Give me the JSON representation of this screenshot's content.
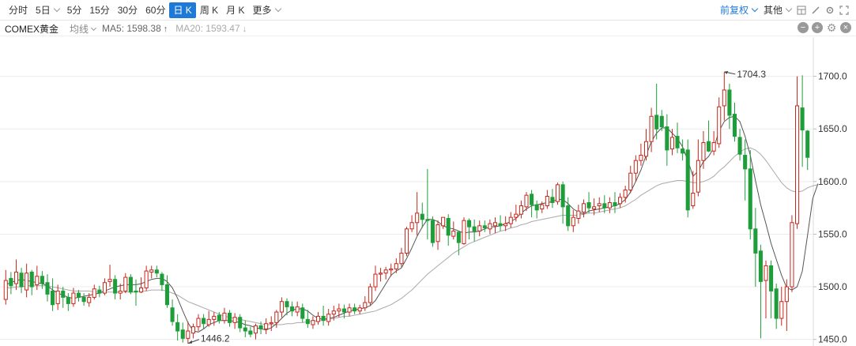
{
  "toolbar": {
    "tabs": [
      {
        "label": "分时",
        "caret": false
      },
      {
        "label": "5日",
        "caret": true
      },
      {
        "label": "5分",
        "caret": false
      },
      {
        "label": "15分",
        "caret": false
      },
      {
        "label": "30分",
        "caret": false
      },
      {
        "label": "60分",
        "caret": false
      },
      {
        "label": "日 K",
        "caret": false,
        "active": true
      },
      {
        "label": "周 K",
        "caret": false
      },
      {
        "label": "月 K",
        "caret": false
      },
      {
        "label": "更多",
        "caret": true
      }
    ],
    "adjust_label": "前复权",
    "other_label": "其他"
  },
  "legend": {
    "symbol": "COMEX黄金",
    "ma_selector": "均线",
    "ma5": "MA5: 1598.38",
    "ma5_arrow": "↑",
    "ma20": "MA20: 1593.47",
    "ma20_arrow": "↓"
  },
  "colors": {
    "up": "#c5281c",
    "down": "#1e9e3a",
    "ma5": "#555555",
    "ma20": "#aaaaaa",
    "accent": "#1e7ad6"
  },
  "chart_data": {
    "type": "candlestick",
    "yticks": [
      "1700.0",
      "1650.0",
      "1600.0",
      "1550.0",
      "1500.0",
      "1450.0"
    ],
    "ylim": [
      1446,
      1735
    ],
    "max_label": "1704.3",
    "min_label": "1446.2",
    "candles": [
      [
        1488,
        1506,
        1516,
        1483
      ],
      [
        1508,
        1501,
        1514,
        1493
      ],
      [
        1503,
        1514,
        1526,
        1497
      ],
      [
        1513,
        1500,
        1518,
        1494
      ],
      [
        1497,
        1513,
        1522,
        1490
      ],
      [
        1514,
        1500,
        1516,
        1492
      ],
      [
        1502,
        1510,
        1520,
        1497
      ],
      [
        1510,
        1503,
        1515,
        1498
      ],
      [
        1504,
        1493,
        1512,
        1486
      ],
      [
        1496,
        1483,
        1508,
        1477
      ],
      [
        1484,
        1496,
        1502,
        1478
      ],
      [
        1496,
        1490,
        1500,
        1480
      ],
      [
        1490,
        1484,
        1494,
        1477
      ],
      [
        1484,
        1494,
        1499,
        1481
      ],
      [
        1494,
        1490,
        1497,
        1486
      ],
      [
        1490,
        1486,
        1494,
        1482
      ],
      [
        1485,
        1490,
        1494,
        1481
      ],
      [
        1490,
        1498,
        1502,
        1488
      ],
      [
        1497,
        1494,
        1501,
        1490
      ],
      [
        1494,
        1504,
        1508,
        1492
      ],
      [
        1505,
        1507,
        1521,
        1500
      ],
      [
        1507,
        1494,
        1511,
        1488
      ],
      [
        1494,
        1496,
        1503,
        1488
      ],
      [
        1496,
        1509,
        1513,
        1494
      ],
      [
        1509,
        1495,
        1512,
        1493
      ],
      [
        1496,
        1495,
        1507,
        1482
      ],
      [
        1495,
        1499,
        1509,
        1494
      ],
      [
        1499,
        1515,
        1520,
        1496
      ],
      [
        1514,
        1516,
        1520,
        1508
      ],
      [
        1516,
        1513,
        1520,
        1509
      ],
      [
        1512,
        1502,
        1514,
        1496
      ],
      [
        1502,
        1483,
        1511,
        1480
      ],
      [
        1480,
        1467,
        1488,
        1463
      ],
      [
        1466,
        1458,
        1474,
        1449
      ],
      [
        1459,
        1451,
        1466,
        1447
      ],
      [
        1451,
        1458,
        1467,
        1446
      ],
      [
        1456,
        1462,
        1465,
        1451
      ],
      [
        1462,
        1470,
        1474,
        1458
      ],
      [
        1470,
        1465,
        1474,
        1460
      ],
      [
        1464,
        1469,
        1477,
        1462
      ],
      [
        1469,
        1472,
        1476,
        1463
      ],
      [
        1473,
        1468,
        1476,
        1465
      ],
      [
        1468,
        1475,
        1480,
        1465
      ],
      [
        1475,
        1466,
        1478,
        1462
      ],
      [
        1466,
        1471,
        1475,
        1460
      ],
      [
        1471,
        1461,
        1474,
        1457
      ],
      [
        1461,
        1458,
        1468,
        1452
      ],
      [
        1458,
        1455,
        1462,
        1452
      ],
      [
        1456,
        1463,
        1465,
        1450
      ],
      [
        1463,
        1460,
        1467,
        1455
      ],
      [
        1460,
        1465,
        1470,
        1455
      ],
      [
        1465,
        1466,
        1472,
        1458
      ],
      [
        1466,
        1476,
        1478,
        1461
      ],
      [
        1476,
        1486,
        1490,
        1471
      ],
      [
        1486,
        1481,
        1489,
        1473
      ],
      [
        1481,
        1477,
        1486,
        1472
      ],
      [
        1476,
        1481,
        1486,
        1472
      ],
      [
        1480,
        1470,
        1484,
        1466
      ],
      [
        1469,
        1465,
        1478,
        1461
      ],
      [
        1464,
        1468,
        1472,
        1460
      ],
      [
        1467,
        1472,
        1476,
        1464
      ],
      [
        1472,
        1468,
        1482,
        1463
      ],
      [
        1467,
        1474,
        1479,
        1463
      ],
      [
        1474,
        1477,
        1482,
        1468
      ],
      [
        1477,
        1479,
        1484,
        1471
      ],
      [
        1479,
        1476,
        1483,
        1470
      ],
      [
        1476,
        1480,
        1484,
        1472
      ],
      [
        1480,
        1477,
        1484,
        1474
      ],
      [
        1477,
        1480,
        1483,
        1474
      ],
      [
        1480,
        1485,
        1491,
        1477
      ],
      [
        1485,
        1500,
        1503,
        1482
      ],
      [
        1500,
        1512,
        1520,
        1496
      ],
      [
        1512,
        1513,
        1518,
        1505
      ],
      [
        1513,
        1516,
        1519,
        1507
      ],
      [
        1516,
        1517,
        1522,
        1510
      ],
      [
        1517,
        1522,
        1527,
        1513
      ],
      [
        1522,
        1532,
        1537,
        1519
      ],
      [
        1532,
        1555,
        1557,
        1529
      ],
      [
        1555,
        1561,
        1568,
        1552
      ],
      [
        1561,
        1570,
        1590,
        1549
      ],
      [
        1569,
        1564,
        1580,
        1556
      ],
      [
        1564,
        1563,
        1612,
        1545
      ],
      [
        1563,
        1542,
        1567,
        1538
      ],
      [
        1543,
        1559,
        1563,
        1535
      ],
      [
        1558,
        1566,
        1566,
        1555
      ],
      [
        1565,
        1549,
        1569,
        1539
      ],
      [
        1548,
        1553,
        1562,
        1545
      ],
      [
        1552,
        1542,
        1552,
        1530
      ],
      [
        1541,
        1563,
        1566,
        1540
      ],
      [
        1563,
        1557,
        1565,
        1545
      ],
      [
        1557,
        1553,
        1564,
        1543
      ],
      [
        1553,
        1558,
        1563,
        1548
      ],
      [
        1558,
        1556,
        1563,
        1552
      ],
      [
        1555,
        1560,
        1564,
        1550
      ],
      [
        1558,
        1561,
        1566,
        1551
      ],
      [
        1560,
        1558,
        1568,
        1553
      ],
      [
        1558,
        1560,
        1567,
        1553
      ],
      [
        1560,
        1566,
        1571,
        1556
      ],
      [
        1566,
        1569,
        1578,
        1562
      ],
      [
        1569,
        1577,
        1582,
        1565
      ],
      [
        1576,
        1587,
        1590,
        1572
      ],
      [
        1588,
        1578,
        1592,
        1566
      ],
      [
        1578,
        1573,
        1582,
        1565
      ],
      [
        1574,
        1578,
        1581,
        1570
      ],
      [
        1577,
        1586,
        1592,
        1574
      ],
      [
        1585,
        1580,
        1593,
        1575
      ],
      [
        1581,
        1597,
        1599,
        1578
      ],
      [
        1597,
        1576,
        1600,
        1560
      ],
      [
        1577,
        1558,
        1585,
        1553
      ],
      [
        1558,
        1566,
        1573,
        1552
      ],
      [
        1565,
        1572,
        1578,
        1560
      ],
      [
        1571,
        1579,
        1583,
        1566
      ],
      [
        1580,
        1575,
        1590,
        1570
      ],
      [
        1574,
        1576,
        1584,
        1568
      ],
      [
        1577,
        1579,
        1585,
        1571
      ],
      [
        1579,
        1575,
        1587,
        1570
      ],
      [
        1575,
        1580,
        1585,
        1570
      ],
      [
        1580,
        1577,
        1590,
        1570
      ],
      [
        1579,
        1585,
        1589,
        1575
      ],
      [
        1585,
        1592,
        1596,
        1580
      ],
      [
        1592,
        1608,
        1615,
        1589
      ],
      [
        1608,
        1620,
        1625,
        1600
      ],
      [
        1620,
        1625,
        1636,
        1615
      ],
      [
        1624,
        1638,
        1650,
        1620
      ],
      [
        1638,
        1662,
        1670,
        1628
      ],
      [
        1663,
        1650,
        1693,
        1640
      ],
      [
        1662,
        1652,
        1668,
        1648
      ],
      [
        1652,
        1630,
        1664,
        1615
      ],
      [
        1631,
        1642,
        1650,
        1625
      ],
      [
        1643,
        1632,
        1656,
        1627
      ],
      [
        1631,
        1627,
        1640,
        1620
      ],
      [
        1630,
        1573,
        1640,
        1566
      ],
      [
        1577,
        1589,
        1610,
        1574
      ],
      [
        1590,
        1620,
        1640,
        1586
      ],
      [
        1620,
        1637,
        1648,
        1612
      ],
      [
        1638,
        1629,
        1658,
        1628
      ],
      [
        1629,
        1637,
        1648,
        1625
      ],
      [
        1636,
        1671,
        1680,
        1632
      ],
      [
        1672,
        1687,
        1704,
        1658
      ],
      [
        1687,
        1663,
        1693,
        1650
      ],
      [
        1664,
        1643,
        1675,
        1638
      ],
      [
        1642,
        1626,
        1650,
        1620
      ],
      [
        1625,
        1612,
        1640,
        1582
      ],
      [
        1612,
        1555,
        1630,
        1545
      ],
      [
        1555,
        1532,
        1575,
        1500
      ],
      [
        1534,
        1505,
        1540,
        1451
      ],
      [
        1506,
        1520,
        1525,
        1470
      ],
      [
        1520,
        1496,
        1525,
        1470
      ],
      [
        1498,
        1470,
        1503,
        1460
      ],
      [
        1470,
        1486,
        1500,
        1463
      ],
      [
        1486,
        1500,
        1507,
        1458
      ],
      [
        1500,
        1561,
        1568,
        1495
      ],
      [
        1560,
        1672,
        1700,
        1555
      ],
      [
        1670,
        1649,
        1701,
        1614
      ],
      [
        1648,
        1623,
        1649,
        1611
      ]
    ],
    "ma5": [
      1502,
      1504,
      1506,
      1507,
      1506,
      1505,
      1504,
      1503,
      1501,
      1497,
      1494,
      1492,
      1490,
      1489,
      1490,
      1491,
      1492,
      1493,
      1494,
      1496,
      1498,
      1500,
      1501,
      1502,
      1502,
      1502,
      1503,
      1505,
      1507,
      1508,
      1508,
      1505,
      1499,
      1489,
      1477,
      1466,
      1458,
      1457,
      1460,
      1464,
      1466,
      1468,
      1468,
      1468,
      1467,
      1466,
      1464,
      1463,
      1461,
      1460,
      1459,
      1461,
      1465,
      1470,
      1475,
      1478,
      1479,
      1479,
      1477,
      1473,
      1470,
      1469,
      1470,
      1471,
      1473,
      1475,
      1477,
      1478,
      1479,
      1480,
      1482,
      1487,
      1495,
      1503,
      1511,
      1515,
      1518,
      1527,
      1537,
      1548,
      1557,
      1564,
      1564,
      1562,
      1558,
      1556,
      1555,
      1553,
      1551,
      1552,
      1552,
      1553,
      1555,
      1557,
      1557,
      1558,
      1560,
      1562,
      1565,
      1570,
      1574,
      1577,
      1578,
      1579,
      1580,
      1581,
      1583,
      1583,
      1579,
      1574,
      1571,
      1569,
      1572,
      1573,
      1574,
      1575,
      1576,
      1577,
      1579,
      1583,
      1590,
      1600,
      1611,
      1625,
      1638,
      1646,
      1651,
      1651,
      1646,
      1641,
      1633,
      1620,
      1605,
      1610,
      1619,
      1624,
      1632,
      1648,
      1657,
      1661,
      1662,
      1657,
      1643,
      1625,
      1601,
      1578,
      1560,
      1541,
      1526,
      1511,
      1499,
      1497,
      1500,
      1515,
      1549,
      1584,
      1598
    ],
    "ma20": [
      1499,
      1499,
      1500,
      1500,
      1501,
      1501,
      1501,
      1501,
      1501,
      1500,
      1499,
      1498,
      1497,
      1496,
      1496,
      1496,
      1496,
      1495,
      1495,
      1495,
      1495,
      1495,
      1495,
      1495,
      1495,
      1495,
      1496,
      1496,
      1497,
      1497,
      1497,
      1496,
      1494,
      1492,
      1489,
      1486,
      1484,
      1482,
      1480,
      1478,
      1476,
      1474,
      1472,
      1471,
      1470,
      1469,
      1468,
      1467,
      1466,
      1465,
      1464,
      1464,
      1464,
      1464,
      1465,
      1465,
      1466,
      1466,
      1467,
      1467,
      1468,
      1468,
      1469,
      1470,
      1471,
      1472,
      1472,
      1473,
      1474,
      1475,
      1476,
      1477,
      1479,
      1481,
      1483,
      1486,
      1489,
      1493,
      1497,
      1502,
      1507,
      1512,
      1516,
      1520,
      1524,
      1528,
      1532,
      1535,
      1538,
      1541,
      1543,
      1545,
      1547,
      1549,
      1551,
      1553,
      1554,
      1556,
      1557,
      1559,
      1560,
      1562,
      1563,
      1564,
      1565,
      1566,
      1567,
      1568,
      1568,
      1568,
      1568,
      1569,
      1570,
      1570,
      1571,
      1572,
      1573,
      1574,
      1575,
      1577,
      1580,
      1583,
      1587,
      1590,
      1593,
      1596,
      1598,
      1599,
      1600,
      1601,
      1601,
      1600,
      1599,
      1599,
      1600,
      1602,
      1605,
      1610,
      1614,
      1619,
      1624,
      1628,
      1631,
      1632,
      1630,
      1626,
      1620,
      1613,
      1606,
      1599,
      1594,
      1591,
      1590,
      1591,
      1594,
      1596,
      1597
    ]
  }
}
